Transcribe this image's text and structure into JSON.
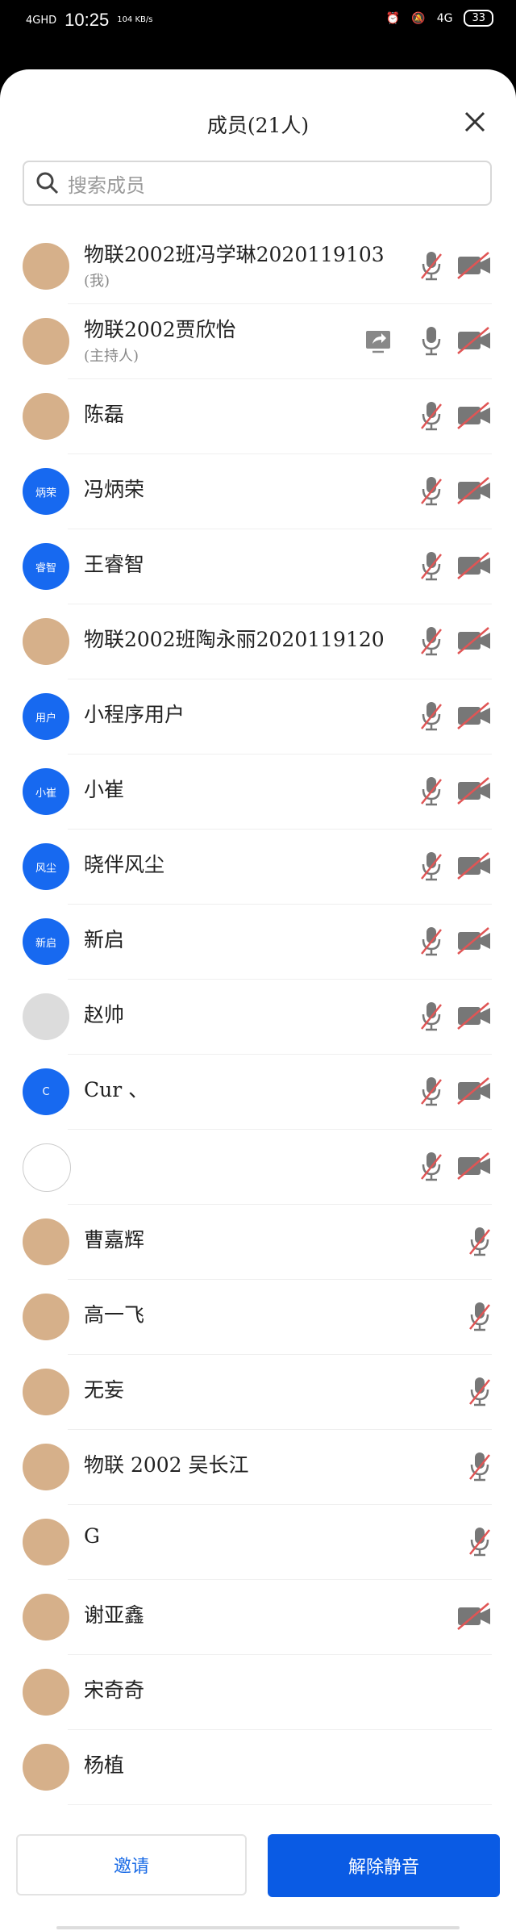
{
  "status": {
    "signal": "4GHD",
    "time": "10:25",
    "speed": "104 KB/s",
    "network": "4G",
    "battery": "33"
  },
  "header": {
    "title": "成员(21人)"
  },
  "search": {
    "placeholder": "搜索成员"
  },
  "members": [
    {
      "name": "物联2002班冯学琳2020119103",
      "sub": "(我)",
      "avatar": "photo",
      "mic": "muted",
      "cam": "off"
    },
    {
      "name": "物联2002贾欣怡",
      "sub": "(主持人)",
      "avatar": "photo",
      "share": true,
      "mic": "on",
      "cam": "off"
    },
    {
      "name": "陈磊",
      "avatar": "photo",
      "mic": "muted",
      "cam": "off"
    },
    {
      "name": "冯炳荣",
      "avatar": "blue",
      "initials": "炳荣",
      "mic": "muted",
      "cam": "off"
    },
    {
      "name": "王睿智",
      "avatar": "blue",
      "initials": "睿智",
      "mic": "muted",
      "cam": "off"
    },
    {
      "name": "物联2002班陶永丽2020119120",
      "avatar": "photo",
      "mic": "muted",
      "cam": "off"
    },
    {
      "name": "小程序用户",
      "avatar": "blue",
      "initials": "用户",
      "mic": "muted",
      "cam": "off"
    },
    {
      "name": "小崔",
      "avatar": "blue",
      "initials": "小崔",
      "mic": "muted",
      "cam": "off"
    },
    {
      "name": "晓伴风尘",
      "avatar": "blue",
      "initials": "风尘",
      "mic": "muted",
      "cam": "off"
    },
    {
      "name": "新启",
      "avatar": "blue",
      "initials": "新启",
      "mic": "muted",
      "cam": "off"
    },
    {
      "name": "赵帅",
      "avatar": "gray",
      "mic": "muted",
      "cam": "off"
    },
    {
      "name": "Cur 、",
      "avatar": "blue",
      "initials": "C",
      "mic": "muted",
      "cam": "off"
    },
    {
      "name": "",
      "avatar": "sketch",
      "mic": "muted",
      "cam": "off"
    },
    {
      "name": "曹嘉辉",
      "avatar": "photo",
      "mic": "muted"
    },
    {
      "name": "高一飞",
      "avatar": "photo",
      "mic": "muted"
    },
    {
      "name": "无妄",
      "avatar": "photo",
      "mic": "muted"
    },
    {
      "name": "物联 2002 吴长江",
      "avatar": "photo",
      "mic": "muted"
    },
    {
      "name": "G",
      "avatar": "photo",
      "mic": "muted"
    },
    {
      "name": "谢亚鑫",
      "avatar": "photo",
      "cam": "off"
    },
    {
      "name": "宋奇奇",
      "avatar": "photo"
    },
    {
      "name": "杨植",
      "avatar": "photo"
    }
  ],
  "footer": {
    "invite": "邀请",
    "unmute_all": "解除静音"
  }
}
